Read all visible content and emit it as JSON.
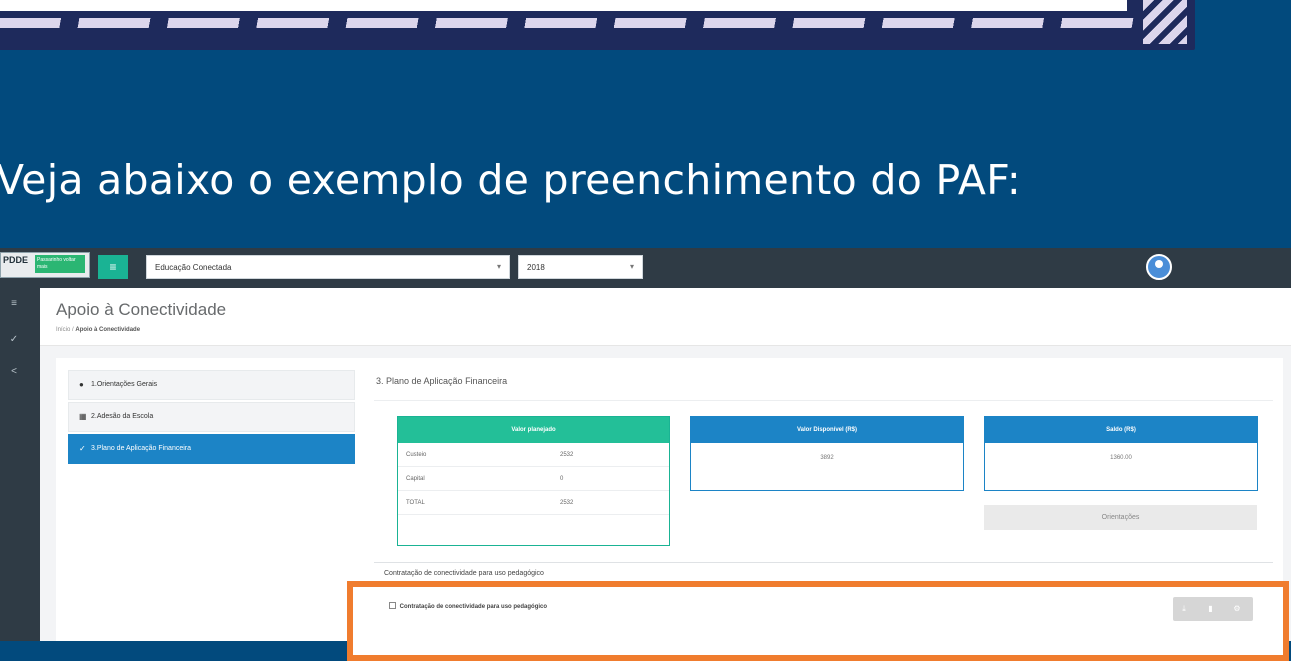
{
  "headline": "Veja abaixo o exemplo de preenchimento do PAF:",
  "app": {
    "logo": {
      "text": "PDDE",
      "badge": "Passarinho voltar mais"
    },
    "menu_icon": "menu-icon",
    "program_select": "Educação Conectada",
    "year_select": "2018",
    "avatar_icon": "user-avatar-icon"
  },
  "left_nav": [
    {
      "icon": "menu-icon",
      "glyph": "≡"
    },
    {
      "icon": "chart-icon",
      "glyph": "✓"
    },
    {
      "icon": "share-icon",
      "glyph": "<"
    }
  ],
  "page": {
    "title": "Apoio à Conectividade",
    "breadcrumb": {
      "home": "Início",
      "sep": "/",
      "current": "Apoio à Conectividade"
    }
  },
  "steps": [
    {
      "label": "1.Orientações Gerais",
      "icon": "eye-icon",
      "glyph": "●",
      "active": false
    },
    {
      "label": "2.Adesão da Escola",
      "icon": "calendar-icon",
      "glyph": "▦",
      "active": false
    },
    {
      "label": "3.Plano de Aplicação Financeira",
      "icon": "chart-icon",
      "glyph": "✓",
      "active": true
    }
  ],
  "section_title": "3. Plano de Aplicação Financeira",
  "cards": {
    "planned": {
      "header": "Valor planejado",
      "rows": [
        {
          "label": "Custeio",
          "value": "2532"
        },
        {
          "label": "Capital",
          "value": "0"
        },
        {
          "label": "TOTAL",
          "value": "2532"
        }
      ]
    },
    "available": {
      "header": "Valor Disponível (R$)",
      "value": "3892"
    },
    "balance": {
      "header": "Saldo (R$)",
      "value": "1360.00"
    }
  },
  "orientacoes_button": "Orientações",
  "subsection_title": "Contratação de conectividade para uso pedagógico",
  "highlight": {
    "checkbox_label": "Contratação de conectividade para uso pedagógico",
    "tools": [
      "download-icon",
      "file-icon",
      "settings-icon"
    ]
  },
  "colors": {
    "background": "#024a7d",
    "topbar": "#2f3b45",
    "green": "#1ab394",
    "blue": "#1c84c6",
    "highlight": "#f07c2e"
  }
}
